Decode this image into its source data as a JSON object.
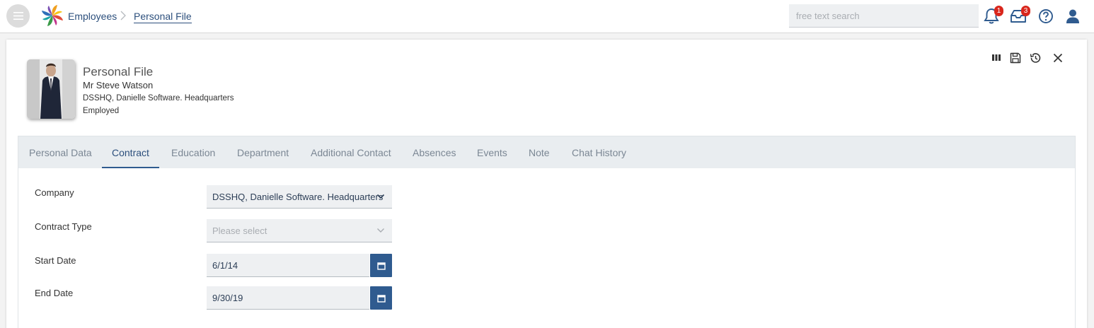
{
  "topbar": {
    "breadcrumb": [
      "Employees",
      "Personal File"
    ],
    "search_placeholder": "free text search",
    "notifications_count": "1",
    "messages_count": "3"
  },
  "profile": {
    "title": "Personal File",
    "name": "Mr Steve Watson",
    "company": "DSSHQ, Danielle Software. Headquarters",
    "status": "Employed"
  },
  "tabs": [
    {
      "label": "Personal Data",
      "active": false
    },
    {
      "label": "Contract",
      "active": true
    },
    {
      "label": "Education",
      "active": false
    },
    {
      "label": "Department",
      "active": false
    },
    {
      "label": "Additional Contact",
      "active": false
    },
    {
      "label": "Absences",
      "active": false
    },
    {
      "label": "Events",
      "active": false
    },
    {
      "label": "Note",
      "active": false
    },
    {
      "label": "Chat History",
      "active": false
    }
  ],
  "form": {
    "company": {
      "label": "Company",
      "value": "DSSHQ, Danielle Software. Headquarters"
    },
    "contract_type": {
      "label": "Contract Type",
      "placeholder": "Please select"
    },
    "start_date": {
      "label": "Start Date",
      "value": "6/1/14"
    },
    "end_date": {
      "label": "End Date",
      "value": "9/30/19"
    }
  },
  "icons": {
    "menu": "hamburger-icon",
    "logo": "pinwheel-logo",
    "notifications": "bell-icon",
    "messages": "inbox-icon",
    "help": "help-icon",
    "user": "user-icon",
    "columns": "columns-icon",
    "save": "save-icon",
    "history": "history-icon",
    "close": "close-icon",
    "calendar": "calendar-icon"
  },
  "colors": {
    "accent": "#2f5b8f",
    "link": "#2c4f7c",
    "badge": "#d9261c",
    "tab_bar": "#e9edf0",
    "field_bg": "#eef0f2"
  }
}
